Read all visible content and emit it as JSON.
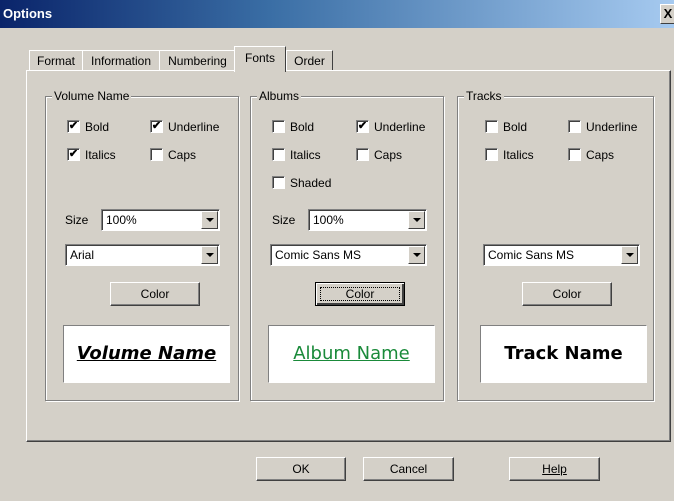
{
  "window": {
    "title": "Options",
    "close_glyph": "X"
  },
  "tabs": [
    {
      "label": "Format",
      "active": false
    },
    {
      "label": "Information",
      "active": false
    },
    {
      "label": "Numbering",
      "active": false
    },
    {
      "label": "Fonts",
      "active": true
    },
    {
      "label": "Order",
      "active": false
    }
  ],
  "groups": {
    "volume": {
      "title": "Volume Name",
      "checkboxes": [
        {
          "label": "Bold",
          "checked": true
        },
        {
          "label": "Underline",
          "checked": true
        },
        {
          "label": "Italics",
          "checked": true
        },
        {
          "label": "Caps",
          "checked": false
        }
      ],
      "size_label": "Size",
      "size_value": "100%",
      "font_value": "Arial",
      "color_button": "Color",
      "preview_text": "Volume Name",
      "preview_color": "#000000"
    },
    "albums": {
      "title": "Albums",
      "checkboxes": [
        {
          "label": "Bold",
          "checked": false
        },
        {
          "label": "Underline",
          "checked": true
        },
        {
          "label": "Italics",
          "checked": false
        },
        {
          "label": "Caps",
          "checked": false
        },
        {
          "label": "Shaded",
          "checked": false
        }
      ],
      "size_label": "Size",
      "size_value": "100%",
      "font_value": "Comic Sans MS",
      "color_button": "Color",
      "preview_text": "Album Name",
      "preview_color": "#1a8a3a"
    },
    "tracks": {
      "title": "Tracks",
      "checkboxes": [
        {
          "label": "Bold",
          "checked": false
        },
        {
          "label": "Underline",
          "checked": false
        },
        {
          "label": "Italics",
          "checked": false
        },
        {
          "label": "Caps",
          "checked": false
        }
      ],
      "font_value": "Comic Sans MS",
      "color_button": "Color",
      "preview_text": "Track Name",
      "preview_color": "#000000"
    }
  },
  "footer": {
    "ok": "OK",
    "cancel": "Cancel",
    "help": "Help"
  },
  "check_glyph": "✔"
}
